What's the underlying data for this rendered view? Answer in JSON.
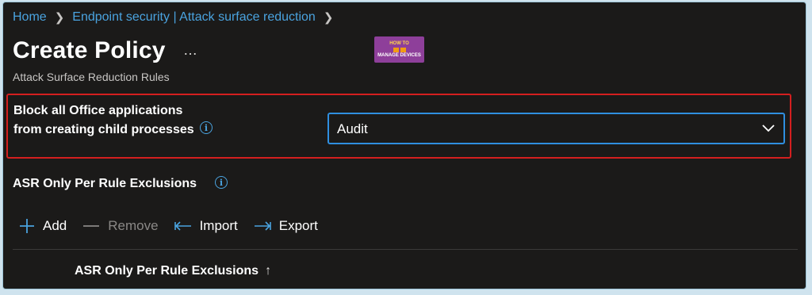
{
  "breadcrumb": {
    "items": [
      "Home",
      "Endpoint security | Attack surface reduction"
    ]
  },
  "header": {
    "title": "Create Policy",
    "more_label": "…",
    "subtitle": "Attack Surface Reduction Rules"
  },
  "logo": {
    "line1": "HOW TO",
    "line2": "MANAGE DEVICES"
  },
  "setting": {
    "label": "Block all Office applications from creating child processes",
    "info_icon": "info-icon",
    "dropdown_value": "Audit"
  },
  "exclusions": {
    "label": "ASR Only Per Rule Exclusions",
    "info_icon": "info-icon"
  },
  "toolbar": {
    "add_label": "Add",
    "remove_label": "Remove",
    "import_label": "Import",
    "export_label": "Export"
  },
  "table": {
    "column_header": "ASR Only Per Rule Exclusions",
    "sort_indicator": "↑"
  },
  "colors": {
    "background": "#1b1a19",
    "link": "#4aa3df",
    "highlight_border": "#d41f1f",
    "focus_border": "#2f8fe0"
  }
}
